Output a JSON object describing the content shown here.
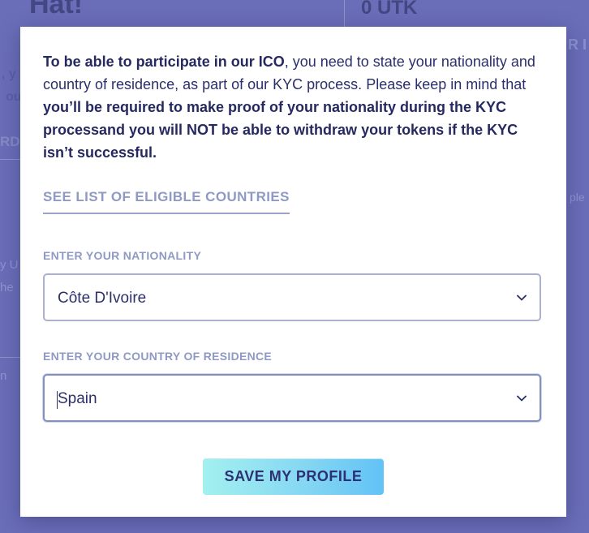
{
  "background": {
    "title_fragment": "Hat!",
    "balance": "0 UTK",
    "tab_fragment": "R I",
    "side_text_1": ", y",
    "side_text_2": "ou",
    "side_tab": "RD",
    "side_text_3": "y U",
    "side_text_4": "he",
    "side_text_5": "n",
    "right_text": "ple"
  },
  "modal": {
    "intro": {
      "part1_bold": "To be able to participate in our ICO",
      "part2": ", you need to state your nationality and country of residence, as part of our KYC process. Please keep in mind that ",
      "part3_bold": "you’ll be required to make proof of your nationality during the KYC processand you will NOT be able to withdraw your tokens if the KYC isn’t successful."
    },
    "eligible_link": "SEE LIST OF ELIGIBLE COUNTRIES",
    "nationality": {
      "label": "ENTER YOUR NATIONALITY",
      "value": "Côte D'Ivoire"
    },
    "residence": {
      "label": "ENTER YOUR COUNTRY OF RESIDENCE",
      "value": "Spain"
    },
    "save_label": "SAVE MY PROFILE"
  },
  "icons": {
    "dropdown": "chevron-down-icon"
  },
  "colors": {
    "overlay": "#6a6eb8",
    "primary_text": "#2b2f6a",
    "label": "#8f9ac4",
    "button_gradient_start": "#a3f0f0",
    "button_gradient_end": "#62c2f6"
  }
}
